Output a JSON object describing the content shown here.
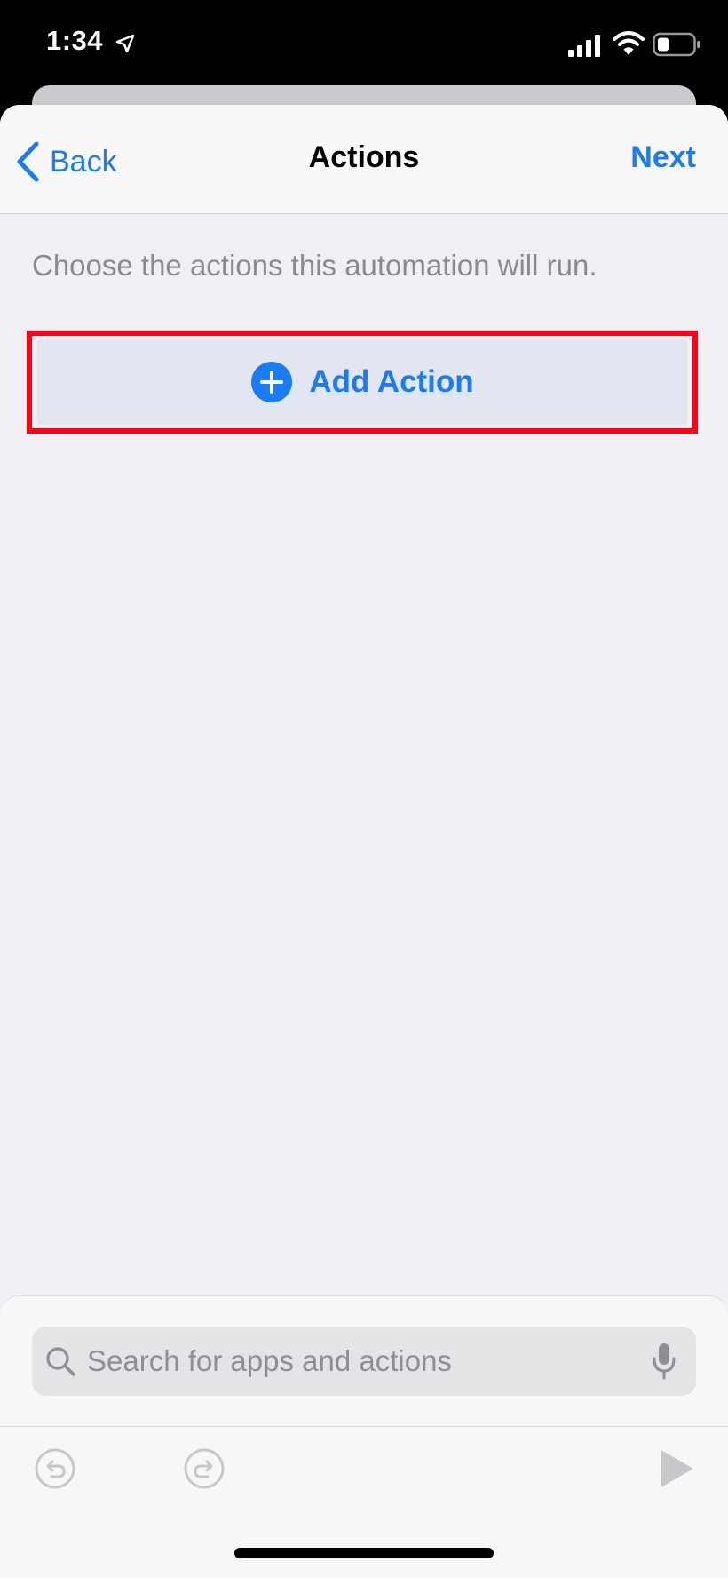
{
  "status_bar": {
    "time": "1:34",
    "icons": [
      "location-arrow-icon",
      "cellular-signal-icon",
      "wifi-icon",
      "battery-icon"
    ]
  },
  "nav": {
    "back_label": "Back",
    "title": "Actions",
    "next_label": "Next"
  },
  "main": {
    "instructions": "Choose the actions this automation will run.",
    "add_action_label": "Add Action"
  },
  "search": {
    "placeholder": "Search for apps and actions",
    "value": ""
  },
  "toolbar": {
    "icons": [
      "undo-icon",
      "redo-icon",
      "play-icon"
    ]
  },
  "colors": {
    "accent": "#1a7cf5",
    "highlight": "#ff0016",
    "background": "#efeff4"
  }
}
